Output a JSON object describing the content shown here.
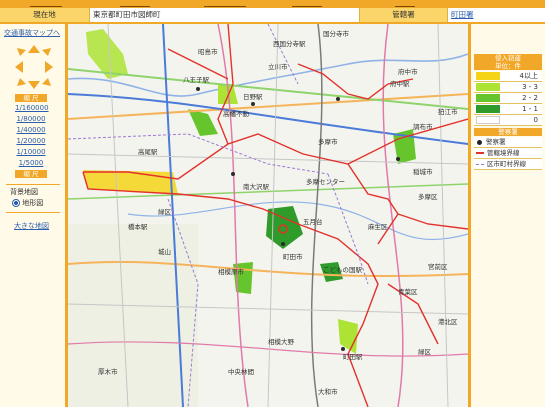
{
  "header": {
    "tabs": [
      "",
      "",
      "",
      "",
      ""
    ],
    "location_label": "現在地",
    "location_value": "東京都町田市図師町",
    "station_label": "管轄署",
    "station_value": "町田署"
  },
  "sidebar": {
    "map_link": "交通事故マップへ",
    "scale_title": "縮 尺",
    "scales": [
      "1/160000",
      "1/80000",
      "1/40000",
      "1/20000",
      "1/10000",
      "1/5000"
    ],
    "scale_bottom": "縮 尺",
    "background_title": "背景地図",
    "background_option": "地形図",
    "large_map_link": "大きな地図"
  },
  "legend": {
    "title": "侵入窃盗",
    "unit": "単位：件",
    "rows": [
      {
        "label": "4以上",
        "color": "#f5d418"
      },
      {
        "label": "3 - 3",
        "color": "#ade334"
      },
      {
        "label": "2 - 2",
        "color": "#66c52c"
      },
      {
        "label": "1 - 1",
        "color": "#2f9b2a"
      },
      {
        "label": "0",
        "color": "#ffffff"
      }
    ],
    "office_title": "警察署",
    "office_items": [
      "警察署",
      "管轄境界線",
      "区市町村界線"
    ]
  },
  "colors": {
    "accent": "#f1a728",
    "crime_boundary": "#e3312b"
  },
  "map_labels": {
    "l1": "国分寺市",
    "l2": "西国分寺駅",
    "l3": "府中市",
    "l4": "府中駅",
    "l5": "八王子駅",
    "l6": "日野駅",
    "l7": "高幡不動",
    "l8": "多摩市",
    "l9": "稲城市",
    "l10": "調布市",
    "l11": "狛江市",
    "l12": "南大沢駅",
    "l13": "橋本駅",
    "l14": "相模原市",
    "l15": "町田市",
    "l16": "町田駅",
    "l17": "多摩センター",
    "l18": "こどもの国駅",
    "l19": "緑区",
    "l20": "青葉区",
    "l21": "相模大野",
    "l22": "厚木市",
    "l23": "大和市",
    "l24": "緑区",
    "l25": "五月台",
    "l26": "中央林間",
    "l27": "麻生区",
    "l28": "宮前区",
    "l29": "多摩区",
    "l30": "高尾駅",
    "l31": "立川市",
    "l32": "昭島市",
    "l33": "城山",
    "l34": "港北区"
  }
}
